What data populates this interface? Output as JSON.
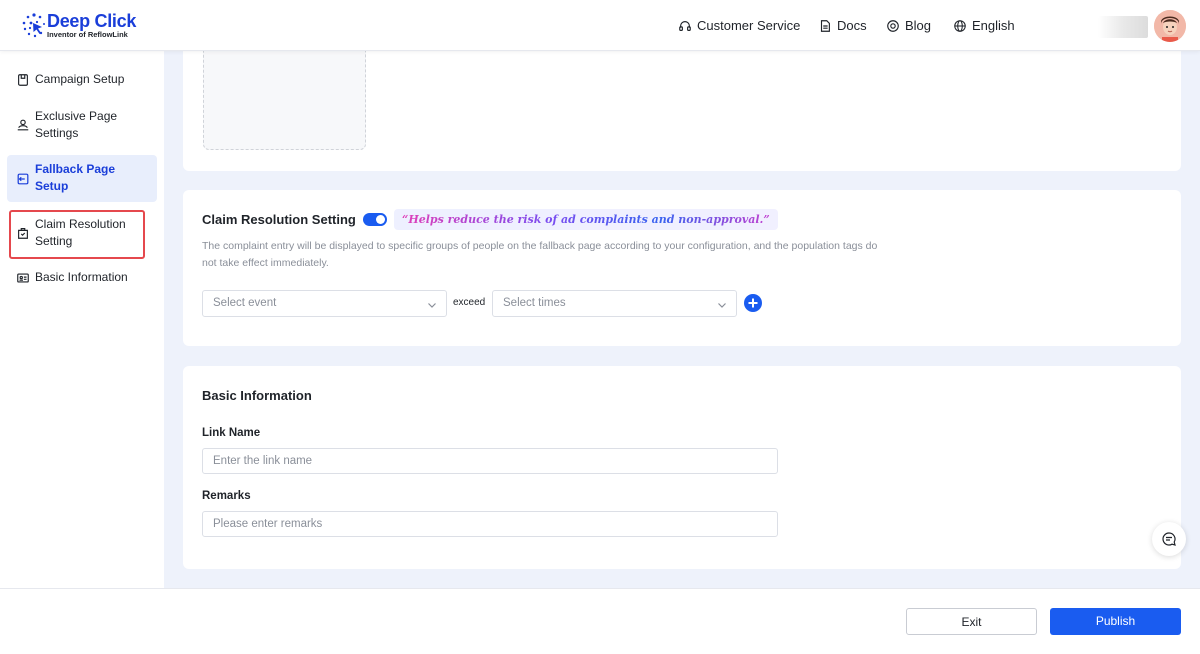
{
  "brand": {
    "title": "Deep Click",
    "subtitle": "Inventor of ReflowLink",
    "color": "#1a3ed9"
  },
  "header": {
    "nav": [
      {
        "label": "Customer Service",
        "icon": "headset-icon"
      },
      {
        "label": "Docs",
        "icon": "document-icon"
      },
      {
        "label": "Blog",
        "icon": "blog-icon"
      },
      {
        "label": "English",
        "icon": "globe-icon"
      }
    ]
  },
  "sidebar": {
    "items": [
      {
        "label": "Campaign Setup",
        "icon": "campaign-icon",
        "active": false
      },
      {
        "label": "Exclusive Page Settings",
        "icon": "exclusive-page-icon",
        "active": false
      },
      {
        "label": "Fallback Page Setup",
        "icon": "fallback-page-icon",
        "active": true
      },
      {
        "label": "Claim Resolution Setting",
        "icon": "claim-resolution-icon",
        "active": false,
        "highlighted": true
      },
      {
        "label": "Basic Information",
        "icon": "id-card-icon",
        "active": false
      }
    ]
  },
  "claim": {
    "title": "Claim Resolution Setting",
    "enabled": true,
    "promo": "“Helps reduce the risk of ad complaints and non-approval.”",
    "description": "The complaint entry will be displayed to specific groups of people on the fallback page according to your configuration, and the population tags do not take effect immediately.",
    "event_placeholder": "Select event",
    "exceed_label": "exceed",
    "times_placeholder": "Select times"
  },
  "basic": {
    "title": "Basic Information",
    "link_name_label": "Link Name",
    "link_name_placeholder": "Enter the link name",
    "remarks_label": "Remarks",
    "remarks_placeholder": "Please enter remarks"
  },
  "footer": {
    "exit_label": "Exit",
    "publish_label": "Publish"
  },
  "colors": {
    "accent": "#1a5cf0",
    "highlight_border": "#e5484d"
  }
}
